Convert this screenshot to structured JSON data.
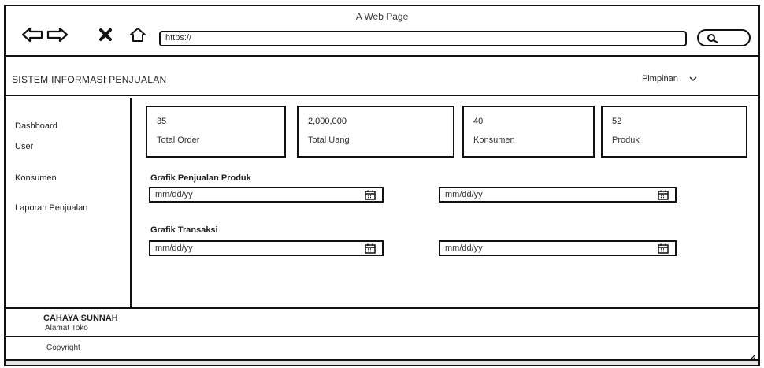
{
  "browser": {
    "window_title": "A Web Page",
    "url": "https://"
  },
  "header": {
    "app_title": "SISTEM INFORMASI PENJUALAN",
    "user_role": "Pimpinan"
  },
  "sidebar": {
    "items": [
      {
        "label": "Dashboard"
      },
      {
        "label": "User"
      },
      {
        "label": "Konsumen"
      },
      {
        "label": "Laporan Penjualan"
      }
    ]
  },
  "stats": [
    {
      "value": "35",
      "label": "Total Order"
    },
    {
      "value": "2,000,000",
      "label": "Total Uang"
    },
    {
      "value": "40",
      "label": "Konsumen"
    },
    {
      "value": "52",
      "label": "Produk"
    }
  ],
  "charts": {
    "sales": {
      "title": "Grafik Penjualan Produk",
      "start_placeholder": "mm/dd/yy",
      "end_placeholder": "mm/dd/yy"
    },
    "transactions": {
      "title": "Grafik Transaksi",
      "start_placeholder": "mm/dd/yy",
      "end_placeholder": "mm/dd/yy"
    }
  },
  "footer": {
    "store_name": "CAHAYA SUNNAH",
    "store_address": "Alamat Toko",
    "copyright": "Copyright"
  }
}
